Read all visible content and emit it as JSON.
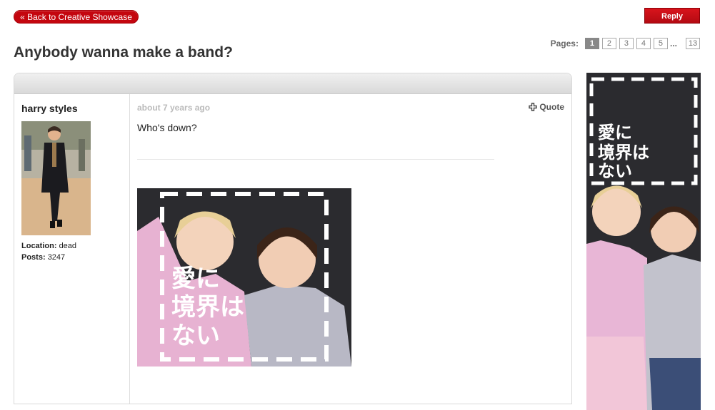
{
  "nav": {
    "back_label": "« Back to Creative Showcase",
    "reply_label": "Reply"
  },
  "pagination": {
    "label": "Pages:",
    "pages": [
      "1",
      "2",
      "3",
      "4",
      "5"
    ],
    "ellipsis": "...",
    "last": "13",
    "current": "1"
  },
  "thread": {
    "title": "Anybody wanna make a band?"
  },
  "post": {
    "author": "harry styles",
    "location_label": "Location:",
    "location": "dead",
    "posts_label": "Posts:",
    "posts": "3247",
    "time": "about 7 years ago",
    "quote_label": "Quote",
    "body": "Who's down?"
  },
  "ad": {
    "slogan_line1": "愛に",
    "slogan_line2": "境界は",
    "slogan_line3": "ない"
  },
  "colors": {
    "accent_red": "#c4060f",
    "ad_dark": "#2b2b2f"
  }
}
